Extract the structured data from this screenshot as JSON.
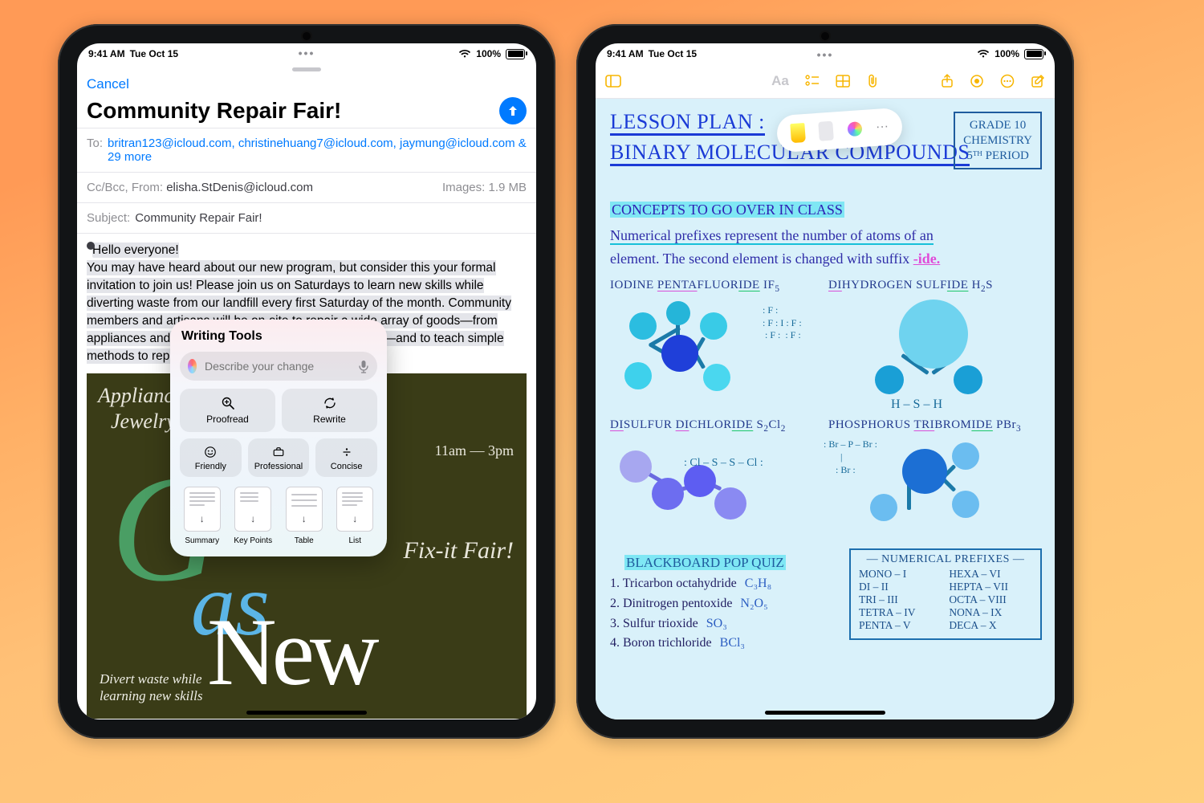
{
  "status": {
    "time": "9:41 AM",
    "date": "Tue Oct 15",
    "battery": "100%"
  },
  "mail": {
    "cancel": "Cancel",
    "title": "Community Repair Fair!",
    "to_label": "To:",
    "to_value": "britran123@icloud.com, christinehuang7@icloud.com, jaymung@icloud.com & 29 more",
    "ccbcc_label": "Cc/Bcc, From:",
    "ccbcc_value": "elisha.StDenis@icloud.com",
    "images_label": "Images: 1.9 MB",
    "subject_label": "Subject:",
    "subject_value": "Community Repair Fair!",
    "body_hello": "Hello everyone!",
    "body_rest": "You may have heard about our new program, but consider this your formal invitation to join us! Please join us on Saturdays to learn new skills while diverting waste from our landfill every first Saturday of the month. Community members and artisans will be on-site to repair a wide array of goods—from appliances and furniture to electronics and appliances—and to teach simple methods to repair common objects around the home.",
    "poster": {
      "line1": "Appliances    Clothing",
      "line2": "Jewelry     & More!",
      "time": "11am — 3pm",
      "fix": "Fix-it Fair!",
      "as": "as",
      "new": "New",
      "g": "G",
      "tag": "Divert waste while learning new skills"
    }
  },
  "writing_tools": {
    "title": "Writing Tools",
    "placeholder": "Describe your change",
    "proofread": "Proofread",
    "rewrite": "Rewrite",
    "friendly": "Friendly",
    "professional": "Professional",
    "concise": "Concise",
    "summary": "Summary",
    "key_points": "Key Points",
    "table": "Table",
    "list": "List"
  },
  "notes": {
    "toolbar": {
      "aa": "Aa"
    },
    "grade": {
      "l1": "GRADE 10",
      "l2": "CHEMISTRY",
      "l3": "5ᵀᴴ PERIOD"
    },
    "title1": "LESSON PLAN :",
    "title2": "BINARY MOLECULAR COMPOUNDS",
    "concepts": "CONCEPTS TO GO OVER IN CLASS",
    "para1": "Numerical prefixes represent the number of atoms of an",
    "para2": "element. The second element is changed with suffix ",
    "ide": "-ide.",
    "c1": "IODINE PENTAFLUORIDE IF₅",
    "c2": "DIHYDROGEN SULFIDE H₂S",
    "c3": "DISULFUR DICHLORIDE S₂Cl₂",
    "c4": "PHOSPHORUS TRIBROMIDE PBr₃",
    "hsh": "H – S – H",
    "clsscl": ": Cl – S – S – Cl :",
    "brpbr": ": Br – P – Br :\n       |\n     : Br :",
    "quiz_hdr": "BLACKBOARD POP QUIZ",
    "quiz": [
      {
        "n": "1.",
        "name": "Tricarbon octahydride",
        "f": "C₃H₈"
      },
      {
        "n": "2.",
        "name": "Dinitrogen pentoxide",
        "f": "N₂O₅"
      },
      {
        "n": "3.",
        "name": "Sulfur trioxide",
        "f": "SO₃"
      },
      {
        "n": "4.",
        "name": "Boron trichloride",
        "f": "BCl₃"
      }
    ],
    "prefix_hdr": "— NUMERICAL PREFIXES —",
    "prefixes": [
      [
        "MONO – I",
        "HEXA – VI"
      ],
      [
        "DI – II",
        "HEPTA – VII"
      ],
      [
        "TRI – III",
        "OCTA – VIII"
      ],
      [
        "TETRA – IV",
        "NONA – IX"
      ],
      [
        "PENTA – V",
        "DECA – X"
      ]
    ],
    "lewis_if5": ": F :\n: F : I : F :\n : F :  : F :"
  }
}
